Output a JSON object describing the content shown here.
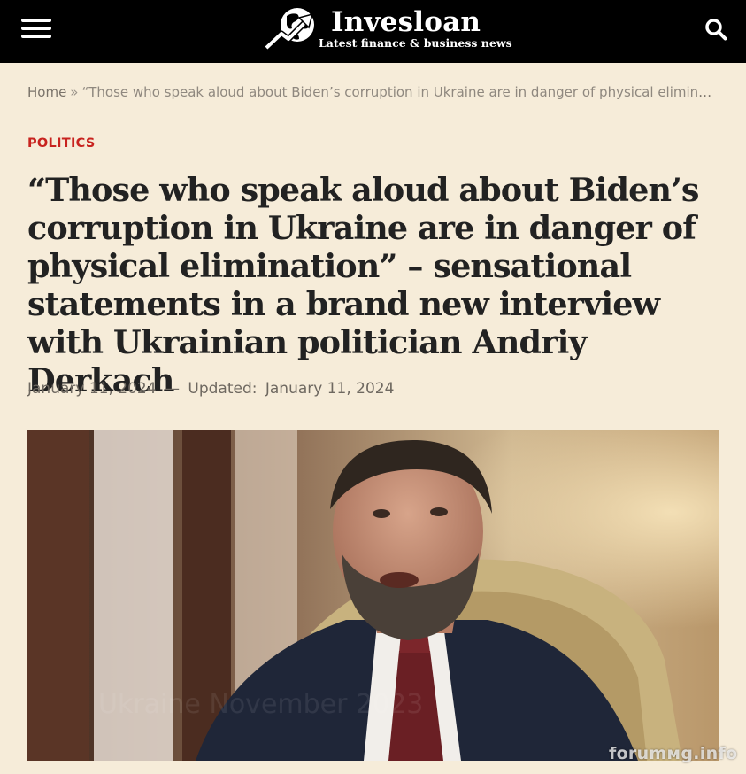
{
  "header": {
    "site_name": "Invesloan",
    "tagline": "Latest finance & business news",
    "colors": {
      "background": "#000000",
      "text": "#ffffff"
    },
    "icons": {
      "menu": "hamburger-menu-icon",
      "search": "search-icon",
      "logo": "globe-arrow-logo"
    }
  },
  "breadcrumb": {
    "home": "Home",
    "separator": "»",
    "current": "“Those who speak aloud about Biden’s corruption in Ukraine are in danger of physical elimination” – sensational statements in a brand new interview with Ukrainian politician Andriy Derkach"
  },
  "article": {
    "category": "POLITICS",
    "title": "“Those who speak aloud about Biden’s corruption in Ukraine are in danger of physical elimination” – sensational statements in a brand new interview with Ukrainian politician Andriy Derkach",
    "published": "January 11, 2024",
    "dash": "—",
    "updated_label": "Updated:",
    "updated": "January 11, 2024",
    "accent_color": "#c8231f"
  },
  "watermark": "forumмg.info",
  "page": {
    "background": "#f6ecd9"
  }
}
